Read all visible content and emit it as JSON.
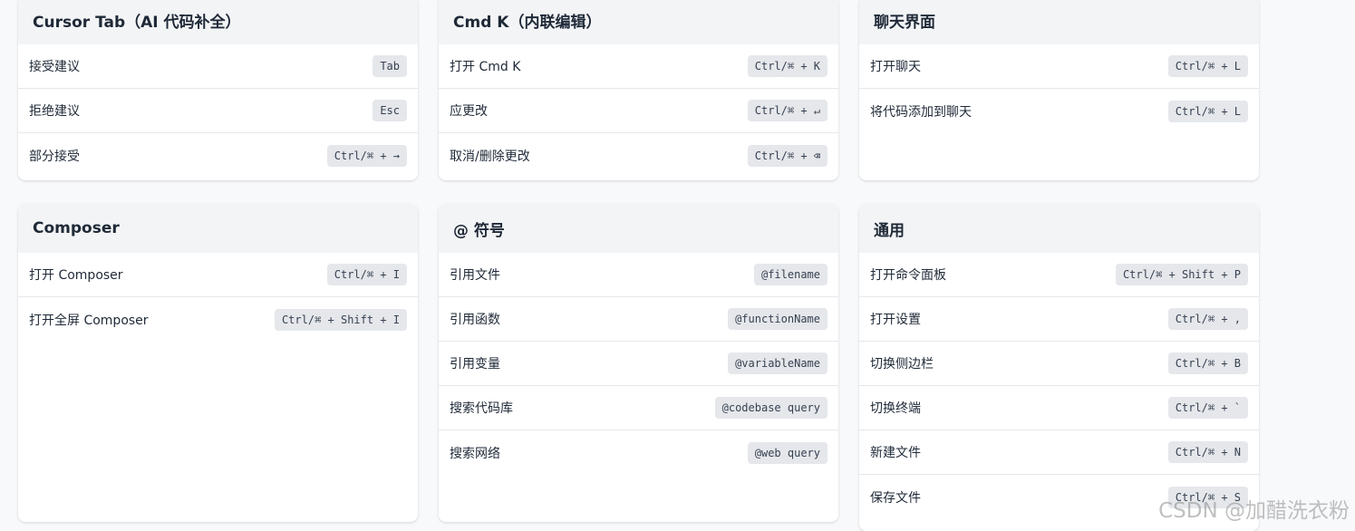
{
  "sections": [
    {
      "title": "Cursor Tab（AI 代码补全）",
      "items": [
        {
          "label": "接受建议",
          "key": "Tab"
        },
        {
          "label": "拒绝建议",
          "key": "Esc"
        },
        {
          "label": "部分接受",
          "key": "Ctrl/⌘ + →"
        }
      ]
    },
    {
      "title": "Cmd K（内联编辑）",
      "items": [
        {
          "label": "打开 Cmd K",
          "key": "Ctrl/⌘ + K"
        },
        {
          "label": "应更改",
          "key": "Ctrl/⌘ + ↵"
        },
        {
          "label": "取消/删除更改",
          "key": "Ctrl/⌘ + ⌫"
        }
      ]
    },
    {
      "title": "聊天界面",
      "items": [
        {
          "label": "打开聊天",
          "key": "Ctrl/⌘ + L"
        },
        {
          "label": "将代码添加到聊天",
          "key": "Ctrl/⌘ + L"
        }
      ]
    },
    {
      "title": "Composer",
      "items": [
        {
          "label": "打开 Composer",
          "key": "Ctrl/⌘ + I"
        },
        {
          "label": "打开全屏 Composer",
          "key": "Ctrl/⌘ + Shift + I"
        }
      ]
    },
    {
      "title": "@ 符号",
      "items": [
        {
          "label": "引用文件",
          "key": "@filename"
        },
        {
          "label": "引用函数",
          "key": "@functionName"
        },
        {
          "label": "引用变量",
          "key": "@variableName"
        },
        {
          "label": "搜索代码库",
          "key": "@codebase query"
        },
        {
          "label": "搜索网络",
          "key": "@web query"
        }
      ]
    },
    {
      "title": "通用",
      "items": [
        {
          "label": "打开命令面板",
          "key": "Ctrl/⌘ + Shift + P"
        },
        {
          "label": "打开设置",
          "key": "Ctrl/⌘ + ,"
        },
        {
          "label": "切换侧边栏",
          "key": "Ctrl/⌘ + B"
        },
        {
          "label": "切换终端",
          "key": "Ctrl/⌘ + `"
        },
        {
          "label": "新建文件",
          "key": "Ctrl/⌘ + N"
        },
        {
          "label": "保存文件",
          "key": "Ctrl/⌘ + S"
        }
      ]
    }
  ],
  "watermark": "CSDN @加醋洗衣粉"
}
